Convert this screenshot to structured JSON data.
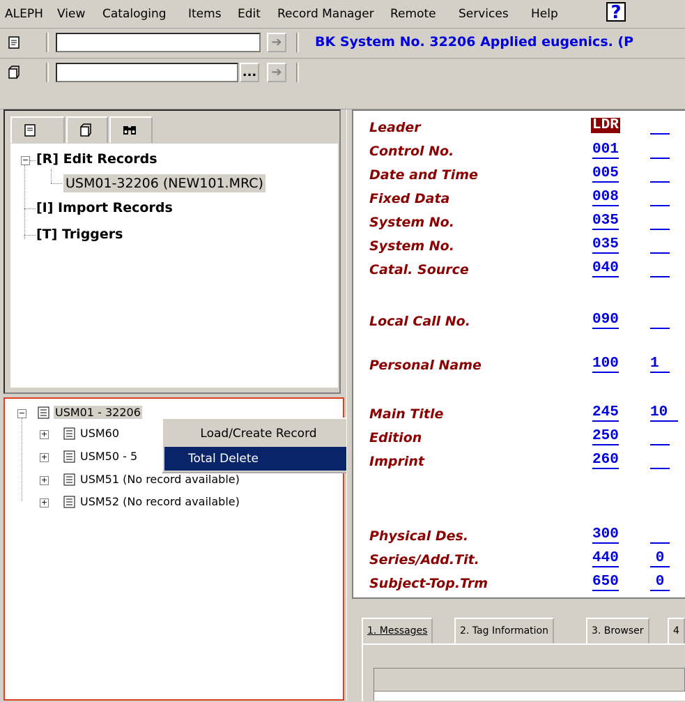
{
  "menu": [
    "ALEPH",
    "View",
    "Cataloging",
    "Items",
    "Edit",
    "Record Manager",
    "Remote",
    "Services",
    "Help"
  ],
  "help_label": "?",
  "toolbar": {
    "record_title": "BK System No. 32206 Applied eugenics. (P",
    "browse_label": "..."
  },
  "tree": {
    "edit_records": "[R] Edit Records",
    "edit_child": "USM01-32206 (NEW101.MRC)",
    "import_records": "[I] Import Records",
    "triggers": "[T] Triggers"
  },
  "libraries": {
    "root": "USM01 - 32206",
    "items": [
      "USM60",
      "USM50 - 5",
      "USM51 (No record available)",
      "USM52 (No record available)"
    ]
  },
  "context_menu": {
    "items": [
      "Load/Create Record",
      "Total Delete"
    ],
    "selected": "Total Delete"
  },
  "fields": [
    {
      "name": "Leader",
      "tag": "LDR",
      "ind": ""
    },
    {
      "name": "Control No.",
      "tag": "001",
      "ind": ""
    },
    {
      "name": "Date and Time",
      "tag": "005",
      "ind": ""
    },
    {
      "name": "Fixed Data",
      "tag": "008",
      "ind": ""
    },
    {
      "name": "System No.",
      "tag": "035",
      "ind": ""
    },
    {
      "name": "System No.",
      "tag": "035",
      "ind": ""
    },
    {
      "name": "Catal. Source",
      "tag": "040",
      "ind": ""
    },
    {
      "name": "Local Call No.",
      "tag": "090",
      "ind": ""
    },
    {
      "name": "Personal Name",
      "tag": "100",
      "ind": "1"
    },
    {
      "name": "Main Title",
      "tag": "245",
      "ind": "10"
    },
    {
      "name": "Edition",
      "tag": "250",
      "ind": ""
    },
    {
      "name": "Imprint",
      "tag": "260",
      "ind": ""
    },
    {
      "name": "Physical Des.",
      "tag": "300",
      "ind": ""
    },
    {
      "name": "Series/Add.Tit.",
      "tag": "440",
      "ind": "0"
    },
    {
      "name": "Subject-Top.Trm",
      "tag": "650",
      "ind": "0"
    }
  ],
  "bottom_tabs": [
    "1. Messages",
    "2. Tag Information",
    "3. Browser",
    "4"
  ]
}
